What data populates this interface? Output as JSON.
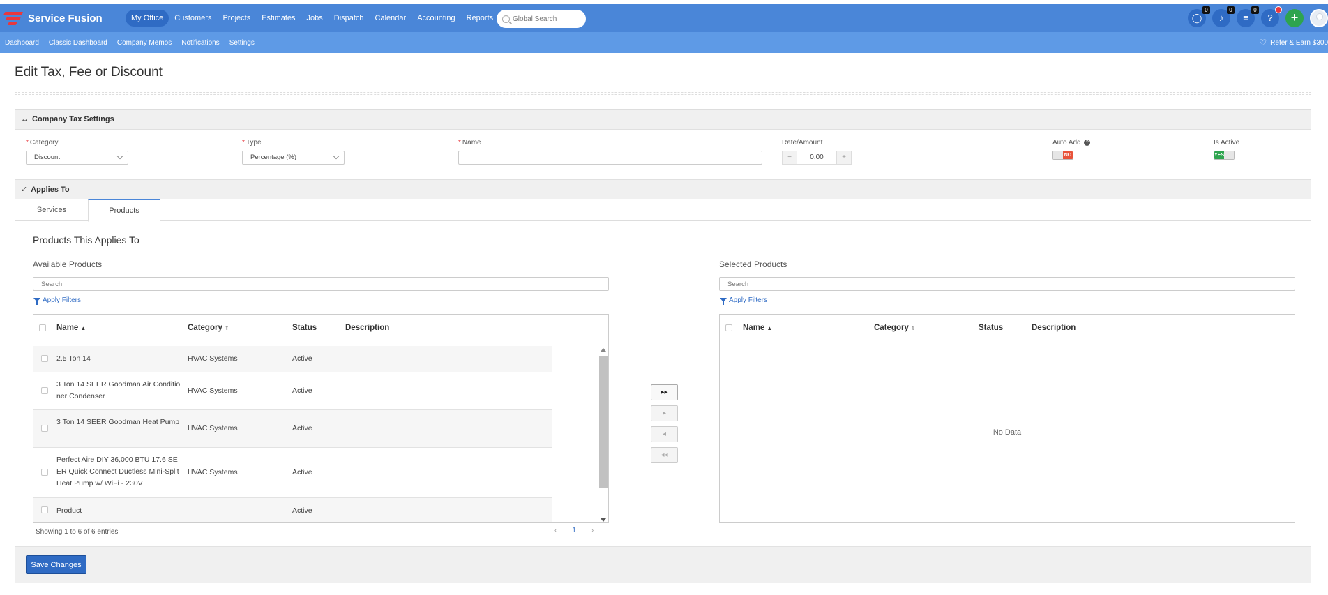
{
  "app": {
    "name": "Service Fusion"
  },
  "nav": {
    "items": [
      "My Office",
      "Customers",
      "Projects",
      "Estimates",
      "Jobs",
      "Dispatch",
      "Calendar",
      "Accounting",
      "Reports"
    ],
    "active": "My Office",
    "search_placeholder": "Global Search"
  },
  "top_icons": {
    "chat_count": "0",
    "notifications_count": "0",
    "tasks_count": "0",
    "help_glyph": "?",
    "plus_glyph": "+",
    "icons": [
      "chat-icon",
      "bell-icon",
      "list-icon",
      "help-icon",
      "add-icon",
      "user-avatar-icon"
    ]
  },
  "subnav": {
    "items": [
      "Dashboard",
      "Classic Dashboard",
      "Company Memos",
      "Notifications",
      "Settings"
    ],
    "refer": "Refer & Earn $300"
  },
  "page": {
    "title": "Edit Tax, Fee or Discount"
  },
  "tax_settings": {
    "header": "Company Tax Settings",
    "category_label": "Category",
    "category_value": "Discount",
    "type_label": "Type",
    "type_value": "Percentage (%)",
    "name_label": "Name",
    "name_value": "",
    "rate_label": "Rate/Amount",
    "rate_value": "0.00",
    "rate_minus": "−",
    "rate_plus": "+",
    "auto_add_label": "Auto Add",
    "auto_add_value": "NO",
    "is_active_label": "Is Active",
    "is_active_value": "YES"
  },
  "applies_to": {
    "header": "Applies To",
    "tabs": [
      "Services",
      "Products"
    ],
    "active_tab": "Products",
    "title": "Products This Applies To"
  },
  "available": {
    "title": "Available Products",
    "search_placeholder": "Search",
    "filters_label": "Apply Filters",
    "columns": [
      "Name",
      "Category",
      "Status",
      "Description"
    ],
    "rows": [
      {
        "name": "2.5 Ton 14",
        "category": "HVAC Systems",
        "status": "Active",
        "description": ""
      },
      {
        "name": "3 Ton 14 SEER Goodman Air Conditioner Condenser",
        "category": "HVAC Systems",
        "status": "Active",
        "description": ""
      },
      {
        "name": "3 Ton 14 SEER Goodman Heat Pump",
        "category": "HVAC Systems",
        "status": "Active",
        "description": ""
      },
      {
        "name": "Perfect Aire DIY 36,000 BTU 17.6 SEER Quick Connect Ductless Mini-Split Heat Pump w/ WiFi - 230V",
        "category": "HVAC Systems",
        "status": "Active",
        "description": ""
      },
      {
        "name": "Product",
        "category": "",
        "status": "Active",
        "description": ""
      }
    ],
    "entries_text": "Showing 1 to 6 of 6 entries",
    "page": "1"
  },
  "selected": {
    "title": "Selected Products",
    "search_placeholder": "Search",
    "filters_label": "Apply Filters",
    "columns": [
      "Name",
      "Category",
      "Status",
      "Description"
    ],
    "empty_text": "No Data"
  },
  "movers": [
    "▸▸",
    "▸",
    "◂",
    "◂◂"
  ],
  "footer": {
    "save_label": "Save Changes"
  },
  "colors": {
    "nav_bg": "#4a86d8",
    "subnav_bg": "#5e9ae6",
    "primary": "#2f6bc4",
    "brand_red": "#e8383d",
    "toggle_no": "#e8533a",
    "toggle_yes": "#2ea44f"
  }
}
